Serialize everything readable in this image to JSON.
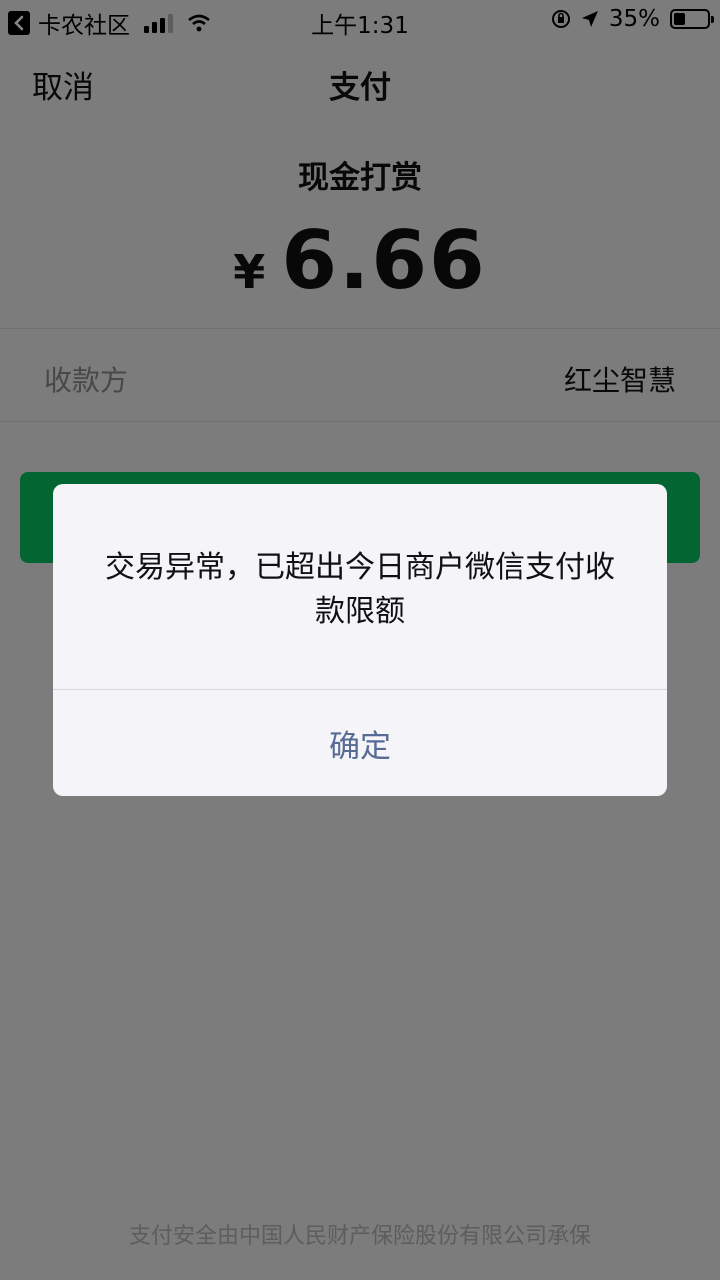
{
  "status_bar": {
    "back_app": "卡农社区",
    "time": "上午1:31",
    "battery": "35%",
    "battery_level": 0.35,
    "icons": [
      "back-arrow-icon",
      "signal-icon",
      "wifi-icon",
      "rotation-lock-icon",
      "location-icon",
      "battery-icon"
    ]
  },
  "nav": {
    "cancel": "取消",
    "title": "支付"
  },
  "payment": {
    "label": "现金打赏",
    "currency": "¥",
    "amount": "6.66",
    "payee_label": "收款方",
    "payee": "红尘智慧",
    "button_color": "#07c160"
  },
  "dialog": {
    "message": "交易异常，已超出今日商户微信支付收款限额",
    "confirm": "确定"
  },
  "footer": "支付安全由中国人民财产保险股份有限公司承保"
}
